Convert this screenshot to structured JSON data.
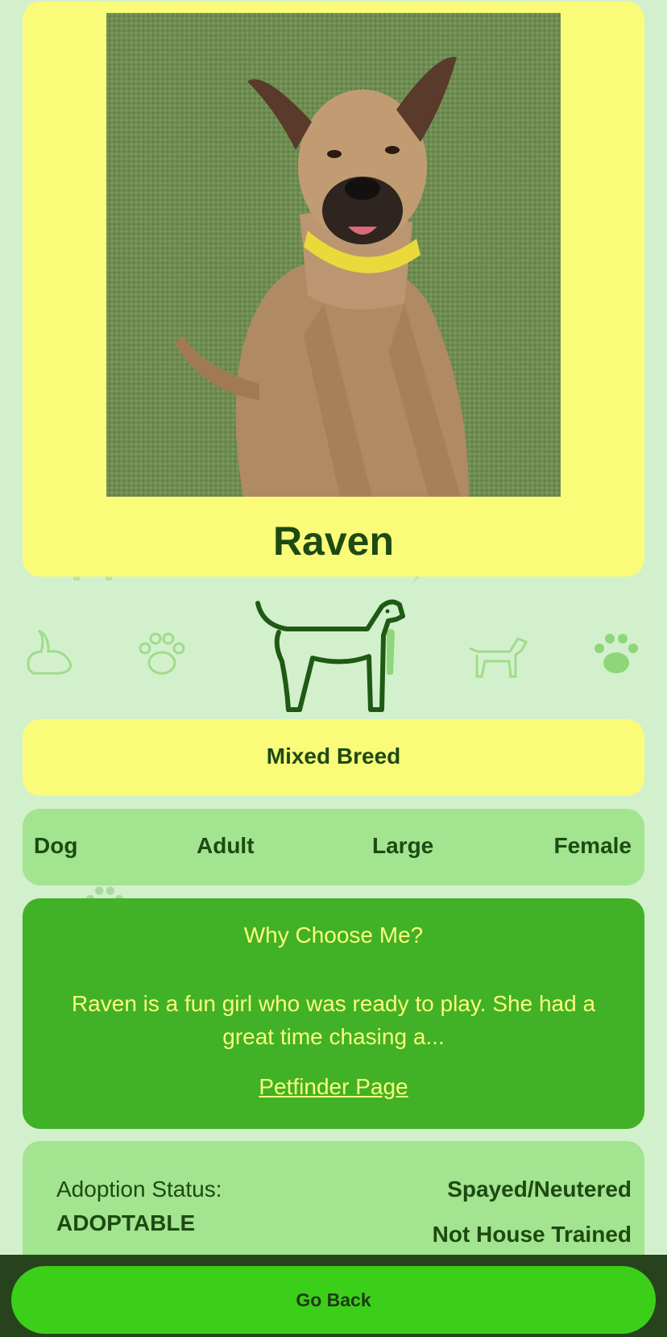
{
  "pet": {
    "name": "Raven",
    "breed": "Mixed Breed",
    "traits": [
      "Dog",
      "Adult",
      "Large",
      "Female"
    ],
    "about_title": "Why Choose Me?",
    "about_text": "Raven is a fun girl who was ready to play. She had a great time chasing a...",
    "link_label": "Petfinder Page",
    "status_label": "Adoption Status:",
    "status_value": "ADOPTABLE",
    "spayed": "Spayed/Neutered",
    "house_trained": "Not House Trained"
  },
  "actions": {
    "back_label": "Go Back"
  },
  "colors": {
    "background": "#d3f0cc",
    "card_yellow": "#fbfb7a",
    "card_light_green": "#a2e48f",
    "card_green": "#41b127",
    "button_green": "#3ccf1a",
    "dark_green_text": "#1d4a12"
  },
  "icons": [
    "dog-outline-icon",
    "paw-icon",
    "rabbit-icon",
    "bone-icon",
    "carrot-icon",
    "horseshoe-icon"
  ]
}
